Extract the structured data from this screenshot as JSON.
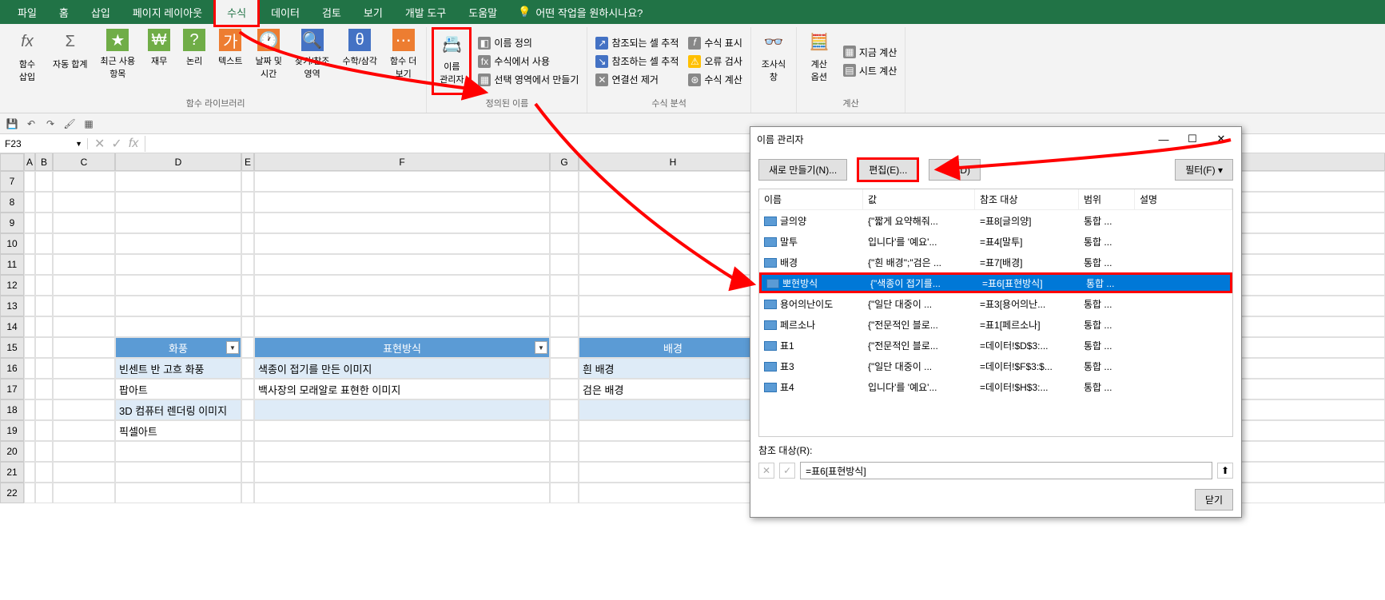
{
  "tabs": [
    "파일",
    "홈",
    "삽입",
    "페이지 레이아웃",
    "수식",
    "데이터",
    "검토",
    "보기",
    "개발 도구",
    "도움말"
  ],
  "activeTab": 4,
  "tellMe": "어떤 작업을 원하시나요?",
  "ribbon": {
    "group1": {
      "fx": "함수\n삽입",
      "autosum": "자동 합계",
      "recent": "최근 사용\n항목",
      "financial": "재무",
      "logical": "논리",
      "text": "텍스트",
      "datetime": "날짜 및\n시간",
      "lookup": "찾기/참조\n영역",
      "math": "수학/삼각",
      "more": "함수 더\n보기",
      "label": "함수 라이브러리"
    },
    "group2": {
      "nameMgr": "이름\n관리자",
      "define": "이름 정의",
      "useIn": "수식에서 사용",
      "createFrom": "선택 영역에서 만들기",
      "label": "정의된 이름"
    },
    "group3": {
      "tracePrec": "참조되는 셀 추적",
      "traceDep": "참조하는 셀 추적",
      "removeArrows": "연결선 제거",
      "showFormulas": "수식 표시",
      "errorCheck": "오류 검사",
      "eval": "수식 계산",
      "label": "수식 분석"
    },
    "group4": {
      "watch": "조사식\n창"
    },
    "group5": {
      "calcOpts": "계산\n옵션",
      "calcNow": "지금 계산",
      "calcSheet": "시트 계산",
      "label": "계산"
    }
  },
  "nameBox": "F23",
  "columns": [
    "A",
    "B",
    "C",
    "D",
    "E",
    "F",
    "G",
    "H"
  ],
  "rowNums": [
    7,
    8,
    9,
    10,
    11,
    12,
    13,
    14,
    15,
    16,
    17,
    18,
    19,
    20,
    21,
    22
  ],
  "tableHeaders": {
    "d": "화풍",
    "f": "표현방식",
    "h": "배경"
  },
  "tableRows": [
    {
      "d": "빈센트 반 고흐 화풍",
      "f": "색종이 접기를 만든 이미지",
      "h": "흰 배경"
    },
    {
      "d": "팝아트",
      "f": "백사장의 모래알로 표현한 이미지",
      "h": "검은 배경"
    },
    {
      "d": "3D 컴퓨터 렌더링 이미지",
      "f": "",
      "h": ""
    },
    {
      "d": "픽셀아트",
      "f": "",
      "h": ""
    }
  ],
  "dialog": {
    "title": "이름 관리자",
    "new": "새로 만들기(N)...",
    "edit": "편집(E)...",
    "delete": "삭제(D)",
    "filter": "필터(F)",
    "cols": {
      "name": "이름",
      "val": "값",
      "ref": "참조 대상",
      "scope": "범위",
      "desc": "설명"
    },
    "rows": [
      {
        "name": "글의양",
        "val": "{\"짧게 요약해줘...",
        "ref": "=표8[글의양]",
        "scope": "통합 ..."
      },
      {
        "name": "말투",
        "val": "입니다'를 '예요'...",
        "ref": "=표4[말투]",
        "scope": "통합 ..."
      },
      {
        "name": "배경",
        "val": "{\"흰 배경\";\"검은 ...",
        "ref": "=표7[배경]",
        "scope": "통합 ..."
      },
      {
        "name": "뽀현방식",
        "val": "{\"색종이 접기를...",
        "ref": "=표6[표현방식]",
        "scope": "통합 ...",
        "sel": true
      },
      {
        "name": "용어의난이도",
        "val": "{\"일단 대중이 ...",
        "ref": "=표3[용어의난...",
        "scope": "통합 ..."
      },
      {
        "name": "페르소나",
        "val": "{\"전문적인 블로...",
        "ref": "=표1[페르소나]",
        "scope": "통합 ..."
      },
      {
        "name": "표1",
        "val": "{\"전문적인 블로...",
        "ref": "=데이터!$D$3:...",
        "scope": "통합 ..."
      },
      {
        "name": "표3",
        "val": "{\"일단 대중이 ...",
        "ref": "=데이터!$F$3:$...",
        "scope": "통합 ..."
      },
      {
        "name": "표4",
        "val": "입니다'를 '예요'...",
        "ref": "=데이터!$H$3:...",
        "scope": "통합 ..."
      }
    ],
    "refersLabel": "참조 대상(R):",
    "refersValue": "=표6[표현방식]",
    "close": "닫기"
  }
}
